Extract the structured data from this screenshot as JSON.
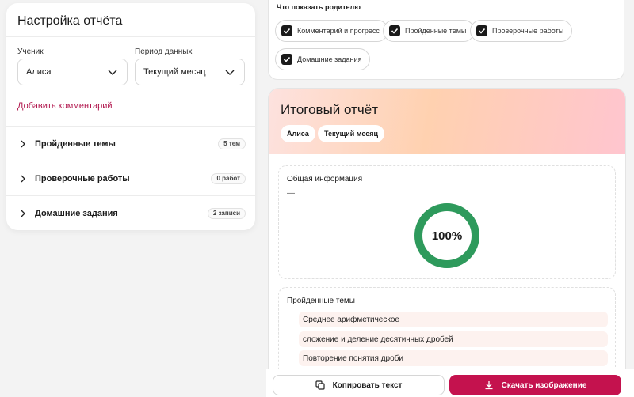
{
  "settings": {
    "title": "Настройка отчёта",
    "student_label": "Ученик",
    "student_value": "Алиса",
    "period_label": "Период данных",
    "period_value": "Текущий месяц",
    "add_comment": "Добавить комментарий",
    "sections": [
      {
        "label": "Пройденные темы",
        "badge": "5 тем"
      },
      {
        "label": "Проверочные работы",
        "badge": "0 работ"
      },
      {
        "label": "Домашние задания",
        "badge": "2 записи"
      }
    ]
  },
  "show_to_parent": {
    "title": "Что показать родителю",
    "options": [
      {
        "label": "Комментарий и прогресс",
        "checked": true
      },
      {
        "label": "Пройденные темы",
        "checked": true
      },
      {
        "label": "Проверочные работы",
        "checked": true
      },
      {
        "label": "Домашние задания",
        "checked": true
      }
    ]
  },
  "report": {
    "title": "Итоговый отчёт",
    "tags": [
      "Алиса",
      "Текущий месяц"
    ],
    "general": {
      "title": "Общая информация",
      "dash": "—",
      "progress_percent": 100,
      "progress_label": "100%",
      "progress_color": "#2e9a5c"
    },
    "topics": {
      "title": "Пройденные темы",
      "items": [
        "Среднее арифметическое",
        "сложение и деление десятичных дробей",
        "Повторение понятия дроби"
      ]
    }
  },
  "actions": {
    "copy_label": "Копировать текст",
    "download_label": "Скачать изображение",
    "accent_color": "#c4124e"
  }
}
